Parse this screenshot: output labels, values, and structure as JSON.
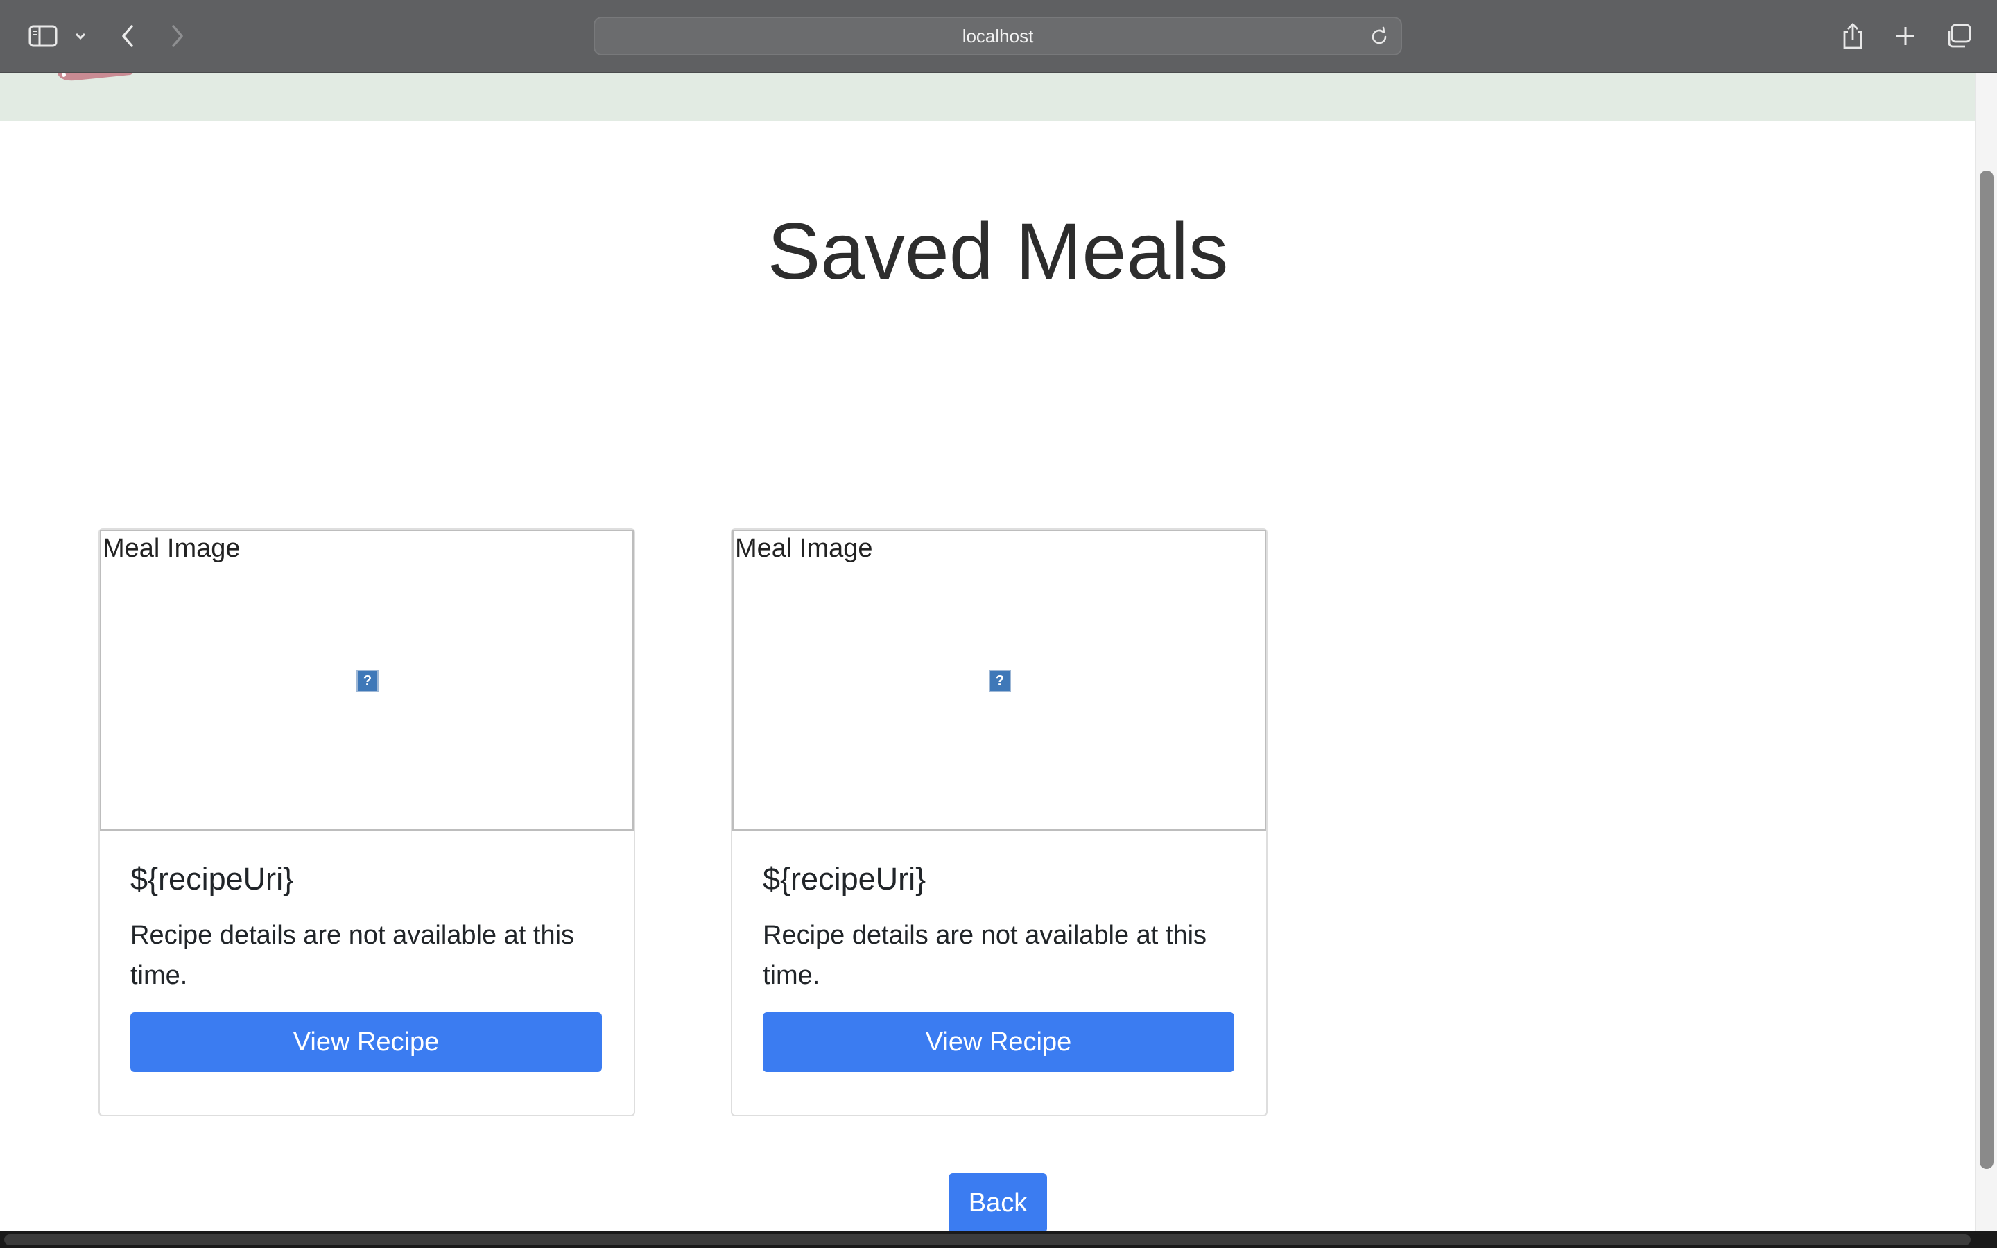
{
  "browser": {
    "address": "localhost"
  },
  "page": {
    "title": "Saved Meals",
    "cards": [
      {
        "image_alt": "Meal Image",
        "title": "${recipeUri}",
        "text": "Recipe details are not available at this time.",
        "button_label": "View Recipe"
      },
      {
        "image_alt": "Meal Image",
        "title": "${recipeUri}",
        "text": "Recipe details are not available at this time.",
        "button_label": "View Recipe"
      }
    ],
    "back_label": "Back"
  },
  "colors": {
    "primary_button": "#3b7cf1",
    "header_band": "#e2ebe3",
    "toolbar": "#5f6062"
  },
  "icons": {
    "toolbar": [
      "sidebar-icon",
      "chevron-down-icon",
      "back-arrow-icon",
      "forward-arrow-icon",
      "reload-icon",
      "share-icon",
      "plus-icon",
      "tabs-overview-icon"
    ],
    "broken_image": "broken-image-icon"
  }
}
